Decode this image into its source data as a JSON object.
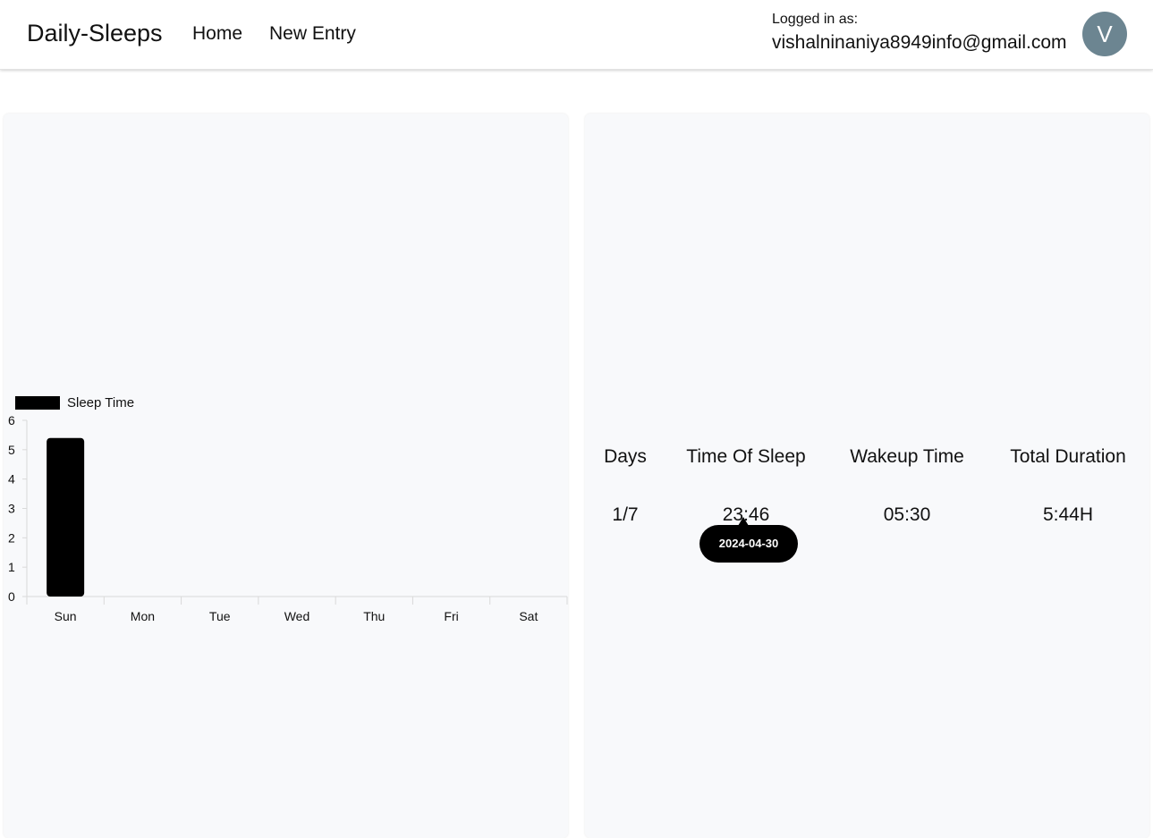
{
  "navbar": {
    "brand": "Daily-Sleeps",
    "links": [
      {
        "label": "Home"
      },
      {
        "label": "New Entry"
      }
    ],
    "logged_in_label": "Logged in as:",
    "user_email": "vishalninaniya8949info@gmail.com",
    "avatar_letter": "V"
  },
  "chart_data": {
    "type": "bar",
    "categories": [
      "Sun",
      "Mon",
      "Tue",
      "Wed",
      "Thu",
      "Fri",
      "Sat"
    ],
    "series": [
      {
        "name": "Sleep Time",
        "values": [
          5.4,
          0,
          0,
          0,
          0,
          0,
          0
        ],
        "color": "#000000"
      }
    ],
    "y_ticks": [
      0,
      1,
      2,
      3,
      4,
      5,
      6
    ],
    "ylim": [
      0,
      6
    ],
    "legend_position": "top-left",
    "grid": false
  },
  "table": {
    "headers": [
      "Days",
      "Time Of Sleep",
      "Wakeup Time",
      "Total Duration"
    ],
    "rows": [
      [
        "1/7",
        "23:46",
        "05:30",
        "5:44H"
      ]
    ]
  },
  "tooltip": {
    "text": "2024-04-30"
  }
}
